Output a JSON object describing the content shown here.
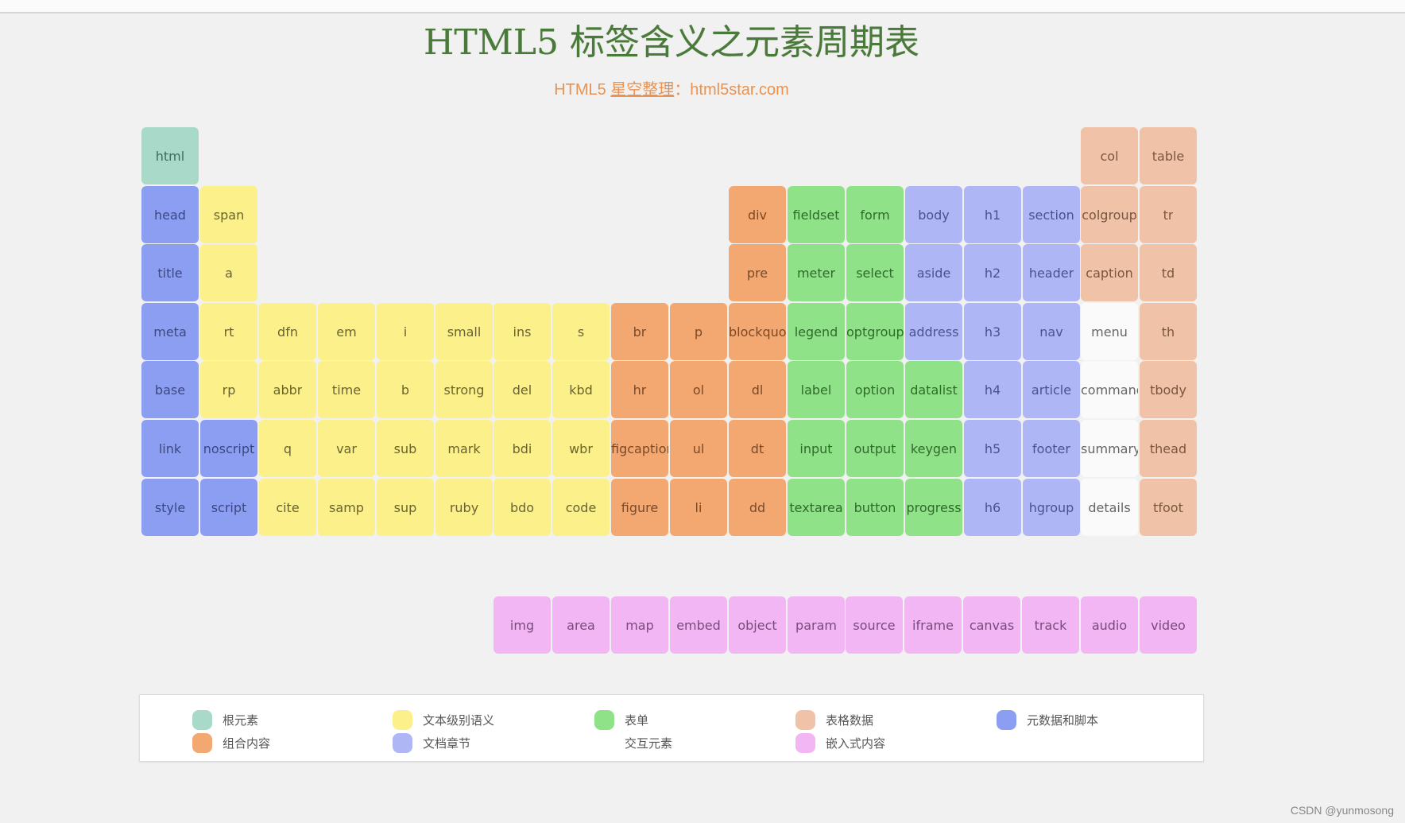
{
  "header": {
    "title": "HTML5 标签含义之元素周期表",
    "subtitle_prefix": "HTML5 ",
    "subtitle_link": "星空整理",
    "subtitle_suffix": "：html5star.com"
  },
  "categories": {
    "root": {
      "label": "根元素",
      "bg": "#a9d9c9",
      "fg": "#3f6b5c"
    },
    "text": {
      "label": "文本级别语义",
      "bg": "#fbf08a",
      "fg": "#6a6330"
    },
    "form": {
      "label": "表单",
      "bg": "#8fe288",
      "fg": "#2f6a2b"
    },
    "table": {
      "label": "表格数据",
      "bg": "#f0c3a8",
      "fg": "#7a5640"
    },
    "meta": {
      "label": "元数据和脚本",
      "bg": "#8c9ef2",
      "fg": "#3c4880"
    },
    "group": {
      "label": "组合内容",
      "bg": "#f3a771",
      "fg": "#7a4a28"
    },
    "section": {
      "label": "文档章节",
      "bg": "#aeb6f6",
      "fg": "#4b5290"
    },
    "interactive": {
      "label": "交互元素",
      "bg": "#fafafa",
      "fg": "#666666"
    },
    "embedded": {
      "label": "嵌入式内容",
      "bg": "#f2b6f4",
      "fg": "#7a4a7e"
    }
  },
  "elements": [
    {
      "tag": "html",
      "row": 0,
      "col": 0,
      "cat": "root"
    },
    {
      "tag": "col",
      "row": 0,
      "col": 16,
      "cat": "table"
    },
    {
      "tag": "table",
      "row": 0,
      "col": 17,
      "cat": "table"
    },
    {
      "tag": "head",
      "row": 1,
      "col": 0,
      "cat": "meta"
    },
    {
      "tag": "span",
      "row": 1,
      "col": 1,
      "cat": "text"
    },
    {
      "tag": "div",
      "row": 1,
      "col": 10,
      "cat": "group"
    },
    {
      "tag": "fieldset",
      "row": 1,
      "col": 11,
      "cat": "form"
    },
    {
      "tag": "form",
      "row": 1,
      "col": 12,
      "cat": "form"
    },
    {
      "tag": "body",
      "row": 1,
      "col": 13,
      "cat": "section"
    },
    {
      "tag": "h1",
      "row": 1,
      "col": 14,
      "cat": "section"
    },
    {
      "tag": "section",
      "row": 1,
      "col": 15,
      "cat": "section"
    },
    {
      "tag": "colgroup",
      "row": 1,
      "col": 16,
      "cat": "table"
    },
    {
      "tag": "tr",
      "row": 1,
      "col": 17,
      "cat": "table"
    },
    {
      "tag": "title",
      "row": 2,
      "col": 0,
      "cat": "meta"
    },
    {
      "tag": "a",
      "row": 2,
      "col": 1,
      "cat": "text"
    },
    {
      "tag": "pre",
      "row": 2,
      "col": 10,
      "cat": "group"
    },
    {
      "tag": "meter",
      "row": 2,
      "col": 11,
      "cat": "form"
    },
    {
      "tag": "select",
      "row": 2,
      "col": 12,
      "cat": "form"
    },
    {
      "tag": "aside",
      "row": 2,
      "col": 13,
      "cat": "section"
    },
    {
      "tag": "h2",
      "row": 2,
      "col": 14,
      "cat": "section"
    },
    {
      "tag": "header",
      "row": 2,
      "col": 15,
      "cat": "section"
    },
    {
      "tag": "caption",
      "row": 2,
      "col": 16,
      "cat": "table"
    },
    {
      "tag": "td",
      "row": 2,
      "col": 17,
      "cat": "table"
    },
    {
      "tag": "meta",
      "row": 3,
      "col": 0,
      "cat": "meta"
    },
    {
      "tag": "rt",
      "row": 3,
      "col": 1,
      "cat": "text"
    },
    {
      "tag": "dfn",
      "row": 3,
      "col": 2,
      "cat": "text"
    },
    {
      "tag": "em",
      "row": 3,
      "col": 3,
      "cat": "text"
    },
    {
      "tag": "i",
      "row": 3,
      "col": 4,
      "cat": "text"
    },
    {
      "tag": "small",
      "row": 3,
      "col": 5,
      "cat": "text"
    },
    {
      "tag": "ins",
      "row": 3,
      "col": 6,
      "cat": "text"
    },
    {
      "tag": "s",
      "row": 3,
      "col": 7,
      "cat": "text"
    },
    {
      "tag": "br",
      "row": 3,
      "col": 8,
      "cat": "group"
    },
    {
      "tag": "p",
      "row": 3,
      "col": 9,
      "cat": "group"
    },
    {
      "tag": "blockquote",
      "row": 3,
      "col": 10,
      "cat": "group"
    },
    {
      "tag": "legend",
      "row": 3,
      "col": 11,
      "cat": "form"
    },
    {
      "tag": "optgroup",
      "row": 3,
      "col": 12,
      "cat": "form"
    },
    {
      "tag": "address",
      "row": 3,
      "col": 13,
      "cat": "section"
    },
    {
      "tag": "h3",
      "row": 3,
      "col": 14,
      "cat": "section"
    },
    {
      "tag": "nav",
      "row": 3,
      "col": 15,
      "cat": "section"
    },
    {
      "tag": "menu",
      "row": 3,
      "col": 16,
      "cat": "interactive"
    },
    {
      "tag": "th",
      "row": 3,
      "col": 17,
      "cat": "table"
    },
    {
      "tag": "base",
      "row": 4,
      "col": 0,
      "cat": "meta"
    },
    {
      "tag": "rp",
      "row": 4,
      "col": 1,
      "cat": "text"
    },
    {
      "tag": "abbr",
      "row": 4,
      "col": 2,
      "cat": "text"
    },
    {
      "tag": "time",
      "row": 4,
      "col": 3,
      "cat": "text"
    },
    {
      "tag": "b",
      "row": 4,
      "col": 4,
      "cat": "text"
    },
    {
      "tag": "strong",
      "row": 4,
      "col": 5,
      "cat": "text"
    },
    {
      "tag": "del",
      "row": 4,
      "col": 6,
      "cat": "text"
    },
    {
      "tag": "kbd",
      "row": 4,
      "col": 7,
      "cat": "text"
    },
    {
      "tag": "hr",
      "row": 4,
      "col": 8,
      "cat": "group"
    },
    {
      "tag": "ol",
      "row": 4,
      "col": 9,
      "cat": "group"
    },
    {
      "tag": "dl",
      "row": 4,
      "col": 10,
      "cat": "group"
    },
    {
      "tag": "label",
      "row": 4,
      "col": 11,
      "cat": "form"
    },
    {
      "tag": "option",
      "row": 4,
      "col": 12,
      "cat": "form"
    },
    {
      "tag": "datalist",
      "row": 4,
      "col": 13,
      "cat": "form"
    },
    {
      "tag": "h4",
      "row": 4,
      "col": 14,
      "cat": "section"
    },
    {
      "tag": "article",
      "row": 4,
      "col": 15,
      "cat": "section"
    },
    {
      "tag": "command",
      "row": 4,
      "col": 16,
      "cat": "interactive"
    },
    {
      "tag": "tbody",
      "row": 4,
      "col": 17,
      "cat": "table"
    },
    {
      "tag": "link",
      "row": 5,
      "col": 0,
      "cat": "meta"
    },
    {
      "tag": "noscript",
      "row": 5,
      "col": 1,
      "cat": "meta"
    },
    {
      "tag": "q",
      "row": 5,
      "col": 2,
      "cat": "text"
    },
    {
      "tag": "var",
      "row": 5,
      "col": 3,
      "cat": "text"
    },
    {
      "tag": "sub",
      "row": 5,
      "col": 4,
      "cat": "text"
    },
    {
      "tag": "mark",
      "row": 5,
      "col": 5,
      "cat": "text"
    },
    {
      "tag": "bdi",
      "row": 5,
      "col": 6,
      "cat": "text"
    },
    {
      "tag": "wbr",
      "row": 5,
      "col": 7,
      "cat": "text"
    },
    {
      "tag": "figcaption",
      "row": 5,
      "col": 8,
      "cat": "group"
    },
    {
      "tag": "ul",
      "row": 5,
      "col": 9,
      "cat": "group"
    },
    {
      "tag": "dt",
      "row": 5,
      "col": 10,
      "cat": "group"
    },
    {
      "tag": "input",
      "row": 5,
      "col": 11,
      "cat": "form"
    },
    {
      "tag": "output",
      "row": 5,
      "col": 12,
      "cat": "form"
    },
    {
      "tag": "keygen",
      "row": 5,
      "col": 13,
      "cat": "form"
    },
    {
      "tag": "h5",
      "row": 5,
      "col": 14,
      "cat": "section"
    },
    {
      "tag": "footer",
      "row": 5,
      "col": 15,
      "cat": "section"
    },
    {
      "tag": "summary",
      "row": 5,
      "col": 16,
      "cat": "interactive"
    },
    {
      "tag": "thead",
      "row": 5,
      "col": 17,
      "cat": "table"
    },
    {
      "tag": "style",
      "row": 6,
      "col": 0,
      "cat": "meta"
    },
    {
      "tag": "script",
      "row": 6,
      "col": 1,
      "cat": "meta"
    },
    {
      "tag": "cite",
      "row": 6,
      "col": 2,
      "cat": "text"
    },
    {
      "tag": "samp",
      "row": 6,
      "col": 3,
      "cat": "text"
    },
    {
      "tag": "sup",
      "row": 6,
      "col": 4,
      "cat": "text"
    },
    {
      "tag": "ruby",
      "row": 6,
      "col": 5,
      "cat": "text"
    },
    {
      "tag": "bdo",
      "row": 6,
      "col": 6,
      "cat": "text"
    },
    {
      "tag": "code",
      "row": 6,
      "col": 7,
      "cat": "text"
    },
    {
      "tag": "figure",
      "row": 6,
      "col": 8,
      "cat": "group"
    },
    {
      "tag": "li",
      "row": 6,
      "col": 9,
      "cat": "group"
    },
    {
      "tag": "dd",
      "row": 6,
      "col": 10,
      "cat": "group"
    },
    {
      "tag": "textarea",
      "row": 6,
      "col": 11,
      "cat": "form"
    },
    {
      "tag": "button",
      "row": 6,
      "col": 12,
      "cat": "form"
    },
    {
      "tag": "progress",
      "row": 6,
      "col": 13,
      "cat": "form"
    },
    {
      "tag": "h6",
      "row": 6,
      "col": 14,
      "cat": "section"
    },
    {
      "tag": "hgroup",
      "row": 6,
      "col": 15,
      "cat": "section"
    },
    {
      "tag": "details",
      "row": 6,
      "col": 16,
      "cat": "interactive"
    },
    {
      "tag": "tfoot",
      "row": 6,
      "col": 17,
      "cat": "table"
    }
  ],
  "embedded_row": [
    "img",
    "area",
    "map",
    "embed",
    "object",
    "param",
    "source",
    "iframe",
    "canvas",
    "track",
    "audio",
    "video"
  ],
  "legend": [
    {
      "cat": "root",
      "label": "根元素"
    },
    {
      "cat": "text",
      "label": "文本级别语义"
    },
    {
      "cat": "form",
      "label": "表单"
    },
    {
      "cat": "table",
      "label": "表格数据"
    },
    {
      "cat": "meta",
      "label": "元数据和脚本"
    },
    {
      "cat": "group",
      "label": "组合内容"
    },
    {
      "cat": "section",
      "label": "文档章节"
    },
    {
      "cat": "interactive",
      "label": "交互元素"
    },
    {
      "cat": "embedded",
      "label": "嵌入式内容"
    }
  ],
  "watermark": "CSDN @yunmosong"
}
